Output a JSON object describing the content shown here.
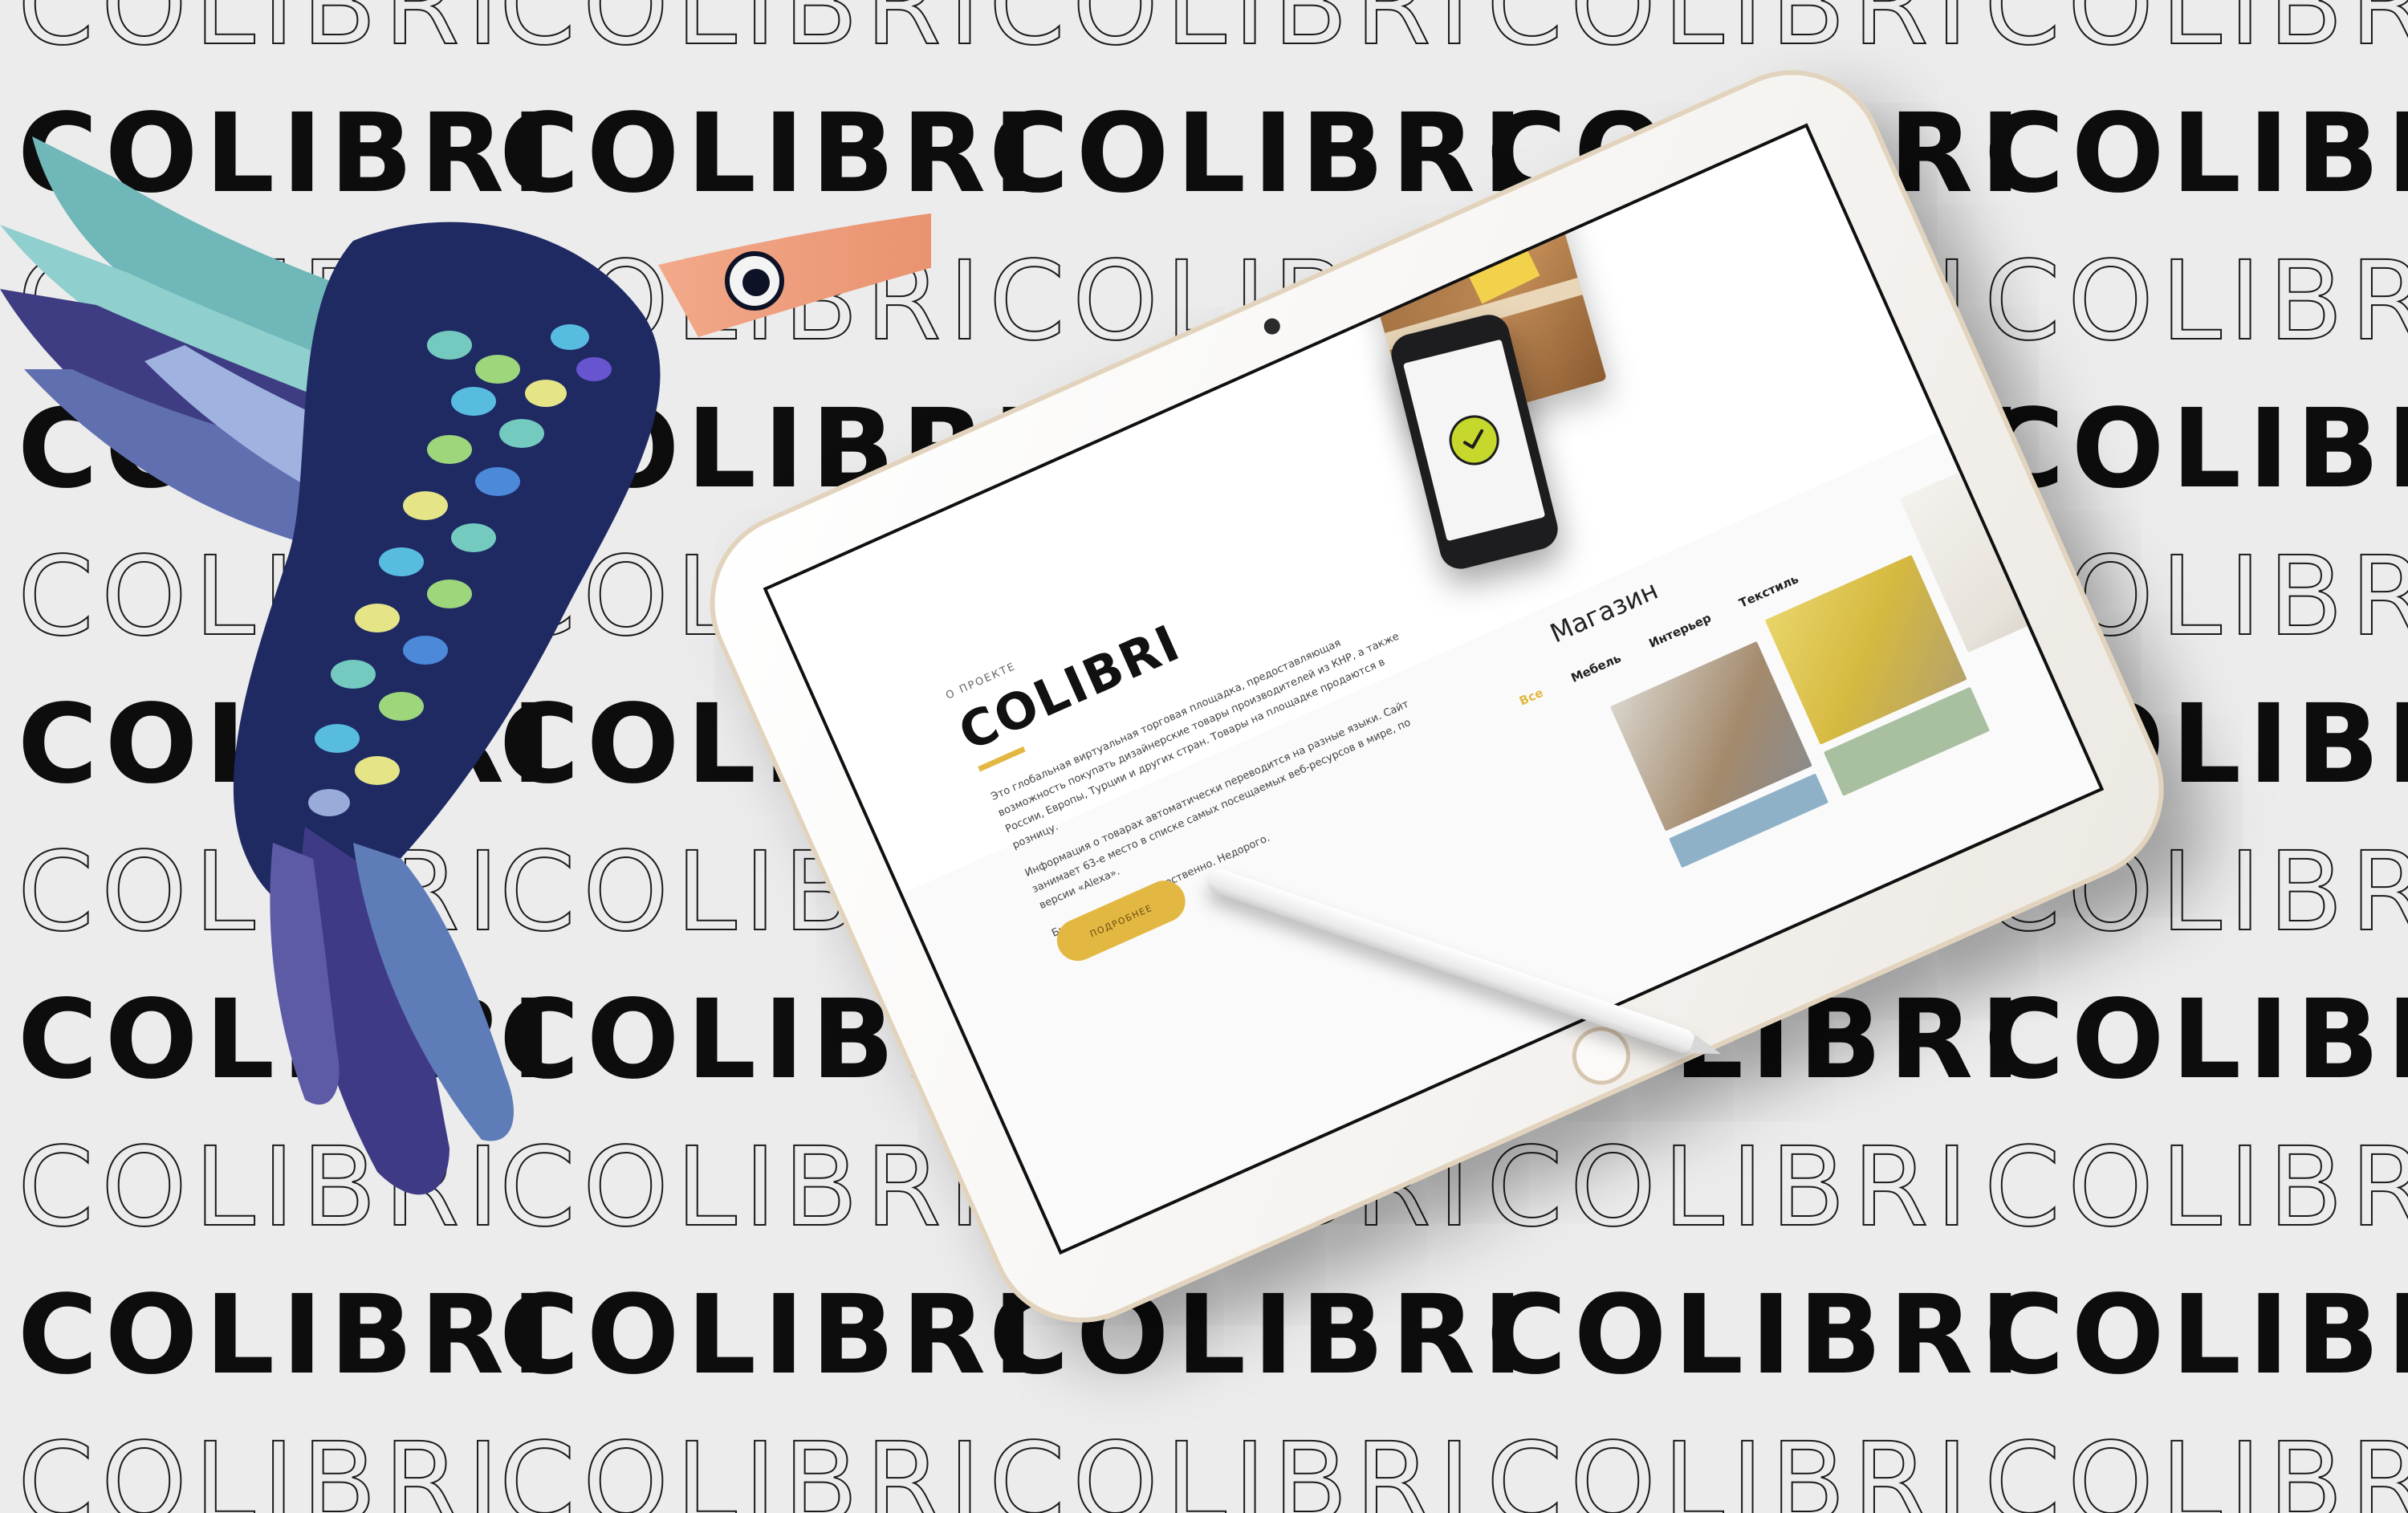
{
  "background": {
    "word": "COLIBRI",
    "colors": {
      "background": "#ececec",
      "text": "#0d0d0d"
    }
  },
  "tablet": {
    "about": {
      "eyebrow": "О ПРОЕКТЕ",
      "title": "COLIBRI",
      "paragraphs": [
        "Это глобальная виртуальная торговая площадка, предоставляющая возможность покупать дизайнерские товары производителей из КНР, а также России, Европы, Турции и других стран. Товары на площадке продаются в розницу.",
        "Информация о товарах автоматически переводится на разные языки. Сайт занимает 63-е место в списке самых посещаемых веб-ресурсов в мире, по версии «Alexa».",
        "Быстро. Надёжно. Качественно. Недорого."
      ],
      "button_label": "ПОДРОБНЕЕ",
      "accent": "#e3b842"
    },
    "shop": {
      "title": "Магазин",
      "tabs": [
        {
          "label": "Все",
          "active": true
        },
        {
          "label": "Мебель",
          "active": false
        },
        {
          "label": "Интерьер",
          "active": false
        },
        {
          "label": "Текстиль",
          "active": false
        }
      ]
    },
    "phone": {
      "icon": "check-icon"
    }
  }
}
